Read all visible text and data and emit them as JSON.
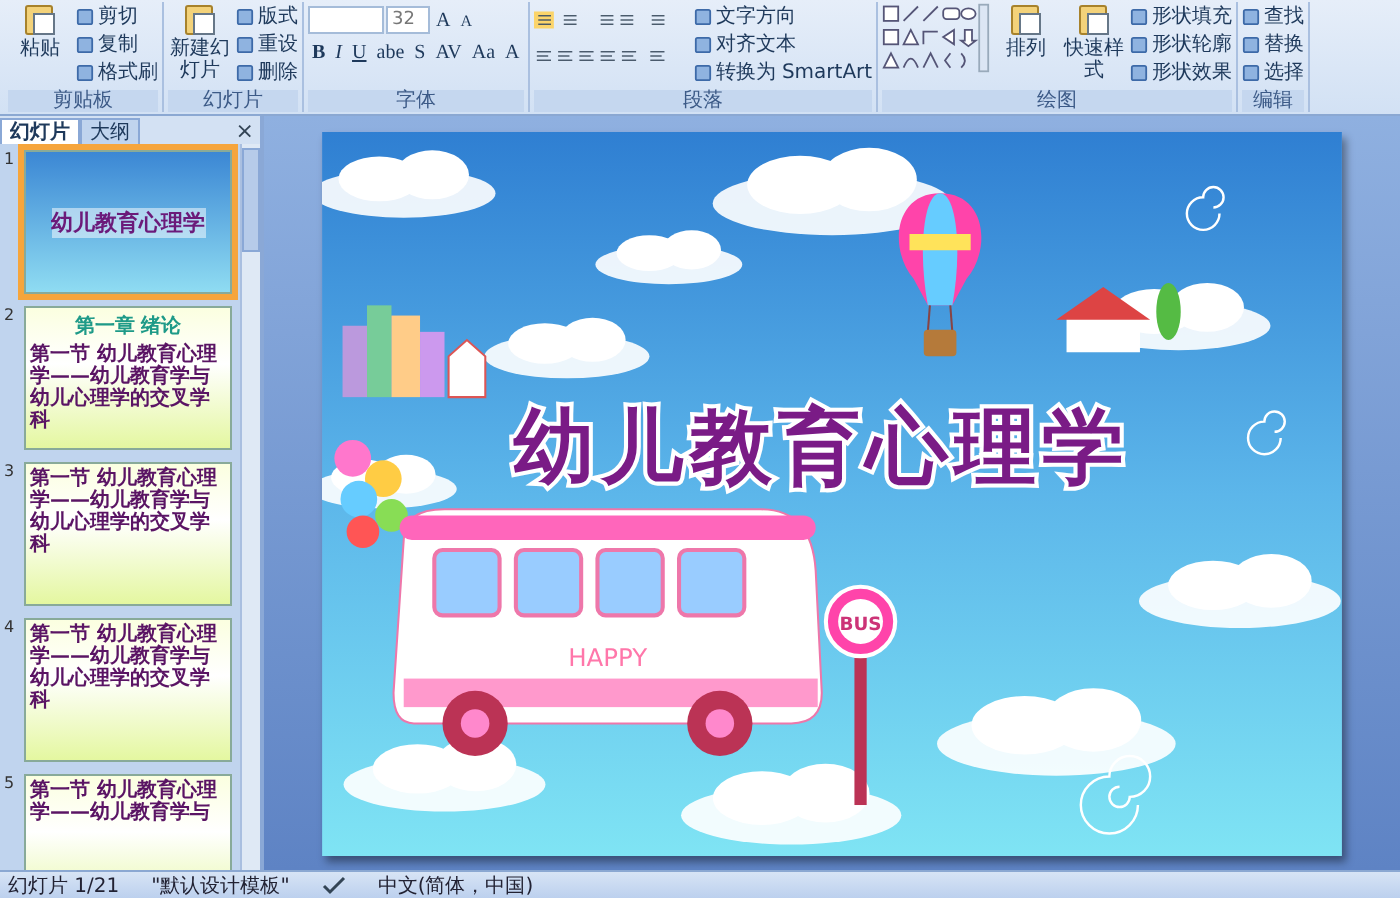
{
  "ribbon": {
    "groups": [
      {
        "kind": "clipboard",
        "label": "剪贴板",
        "large": [
          "粘贴"
        ],
        "small": [
          "剪切",
          "复制",
          "格式刷"
        ]
      },
      {
        "kind": "slides",
        "label": "幻灯片",
        "large": [
          "新建幻灯片"
        ],
        "small": [
          "版式",
          "重设",
          "删除"
        ]
      },
      {
        "kind": "font",
        "label": "字体",
        "font_size": "32",
        "size_buttons": [
          "A",
          "A"
        ],
        "format_buttons": [
          "B",
          "I",
          "U",
          "abe",
          "S",
          "AV",
          "Aa",
          "A"
        ]
      },
      {
        "kind": "paragraph",
        "label": "段落",
        "small": [
          "文字方向",
          "对齐文本",
          "转换为 SmartArt"
        ]
      },
      {
        "kind": "drawing",
        "label": "绘图",
        "large": [
          "排列",
          "快速样式"
        ],
        "small": [
          "形状填充",
          "形状轮廓",
          "形状效果"
        ]
      },
      {
        "kind": "editing",
        "label": "编辑",
        "small": [
          "查找",
          "替换",
          "选择"
        ]
      }
    ]
  },
  "pane": {
    "tabs": [
      {
        "label": "幻灯片",
        "selected": true
      },
      {
        "label": "大纲",
        "selected": false
      }
    ],
    "close": "×",
    "thumbnails": [
      {
        "number": "1",
        "selected": true,
        "kind": "cover",
        "title": "幼儿教育心理学"
      },
      {
        "number": "2",
        "selected": false,
        "kind": "content",
        "title": "第一章 绪论",
        "heading": "第一节 幼儿教育心理学——幼儿教育学与幼儿心理学的交叉学科"
      },
      {
        "number": "3",
        "selected": false,
        "kind": "content",
        "heading": "第一节 幼儿教育心理学——幼儿教育学与幼儿心理学的交叉学科"
      },
      {
        "number": "4",
        "selected": false,
        "kind": "content",
        "heading": "第一节 幼儿教育心理学——幼儿教育学与幼儿心理学的交叉学科"
      },
      {
        "number": "5",
        "selected": false,
        "kind": "content",
        "heading": "第一节 幼儿教育心理学——幼儿教育学与"
      }
    ]
  },
  "slide": {
    "title": "幼儿教育心理学",
    "bus_text": "HAPPY",
    "sign_text": "BUS"
  },
  "status_bar": {
    "slide": "幻灯片 1/21",
    "theme": "\"默认设计模板\"",
    "language": "中文(简体，中国)"
  }
}
